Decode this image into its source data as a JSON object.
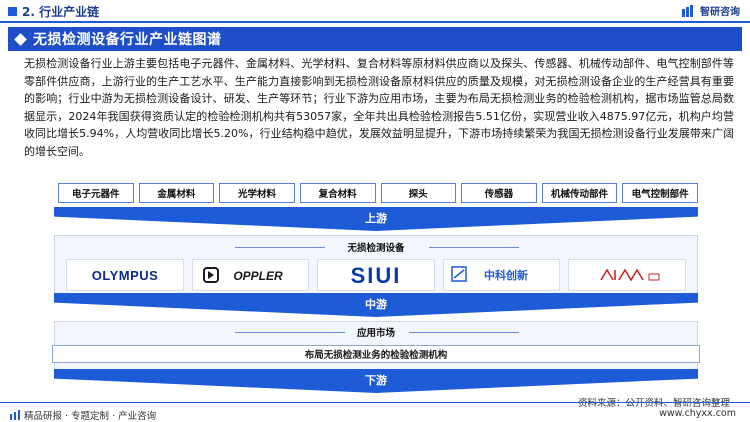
{
  "header": {
    "section": "2. 行业产业链",
    "brand": "智研咨询"
  },
  "banner": {
    "title": "无损检测设备行业产业链图谱"
  },
  "paragraph": "无损检测设备行业上游主要包括电子元器件、金属材料、光学材料、复合材料等原材料供应商以及探头、传感器、机械传动部件、电气控制部件等零部件供应商，上游行业的生产工艺水平、生产能力直接影响到无损检测设备原材料供应的质量及规模，对无损检测设备企业的生产经营具有重要的影响；行业中游为无损检测设备设计、研发、生产等环节；行业下游为应用市场，主要为布局无损检测业务的检验检测机构，据市场监管总局数据显示，2024年我国获得资质认定的检验检测机构共有53057家，全年共出具检验检测报告5.51亿份，实现营业收入4875.97亿元，机构户均营收同比增长5.94%，人均营收同比增长5.20%，行业结构稳中趋优，发展效益明显提升，下游市场持续繁荣为我国无损检测设备行业发展带来广阔的增长空间。",
  "upstream": {
    "items": [
      "电子元器件",
      "金属材料",
      "光学材料",
      "复合材料",
      "探头",
      "传感器",
      "机械传动部件",
      "电气控制部件"
    ],
    "label": "上游"
  },
  "midstream": {
    "heading": "无损检测设备",
    "logos": [
      "OLYMPUS",
      "DOPPLER",
      "SIUI",
      "中科创新",
      "logo-5"
    ],
    "label": "中游"
  },
  "downstream": {
    "heading": "应用市场",
    "item": "布局无损检测业务的检验检测机构",
    "label": "下游"
  },
  "footer": {
    "left": "精品研报 · 专题定制 · 产业咨询",
    "right": "www.chyxx.com",
    "source": "资料来源：公开资料、智研咨询整理"
  },
  "colors": {
    "primary": "#1e5bd6",
    "banner": "#1e4fc8"
  }
}
